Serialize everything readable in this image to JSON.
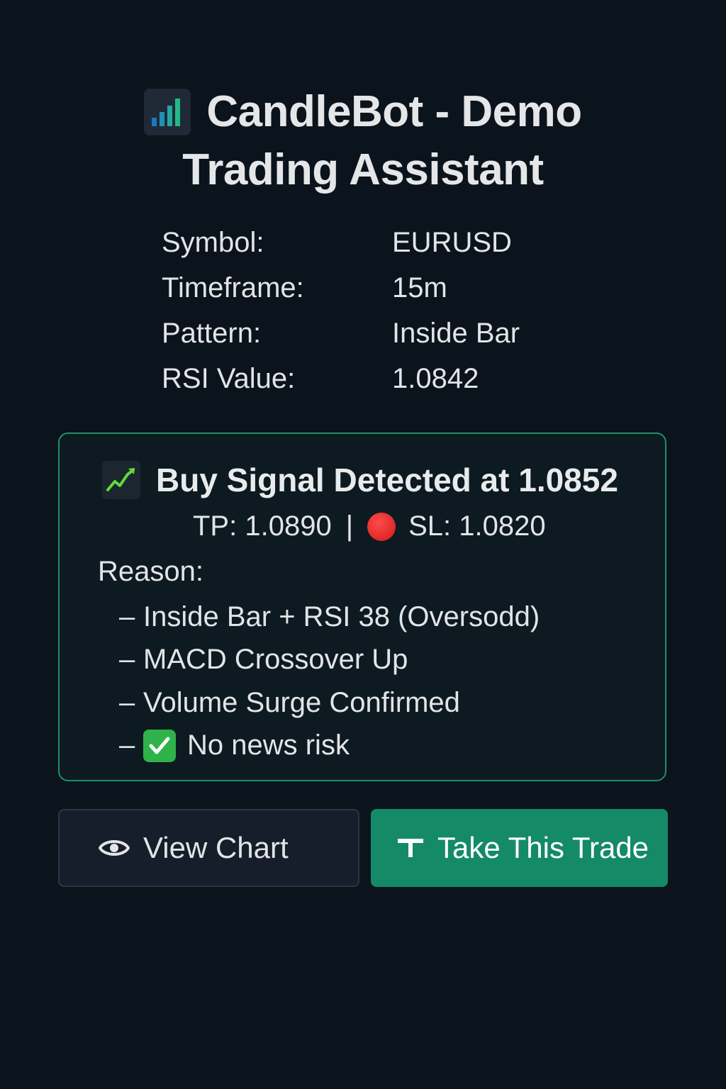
{
  "header": {
    "title_line1": "CandleBot - Demo",
    "title_line2": "Trading Assistant",
    "icon": "bar-chart-icon"
  },
  "info": [
    {
      "label": "Symbol:",
      "value": "EURUSD"
    },
    {
      "label": "Timeframe:",
      "value": "15m"
    },
    {
      "label": "Pattern:",
      "value": "Inside Bar"
    },
    {
      "label": "RSI Value:",
      "value": "1.0842"
    }
  ],
  "signal": {
    "icon": "chart-increasing-icon",
    "heading": "Buy Signal Detected at 1.0852",
    "tp": "TP: 1.0890",
    "separator": "|",
    "sl_icon": "red-circle-icon",
    "sl": "SL: 1.0820",
    "reason_label": "Reason:",
    "dash": "–",
    "reasons": [
      "Inside  Bar + RSI 38 (Oversodd)",
      "MACD Crossover Up",
      "Volume Surge Confirmed",
      "No news risk"
    ],
    "last_reason_icon": "check-mark-icon",
    "accent_color": "#1f8f66"
  },
  "actions": {
    "view_chart_label": "View Chart",
    "view_chart_icon": "eye-icon",
    "take_trade_label": "Take This Trade",
    "take_trade_icon": "t-icon",
    "take_trade_color": "#148a66"
  }
}
